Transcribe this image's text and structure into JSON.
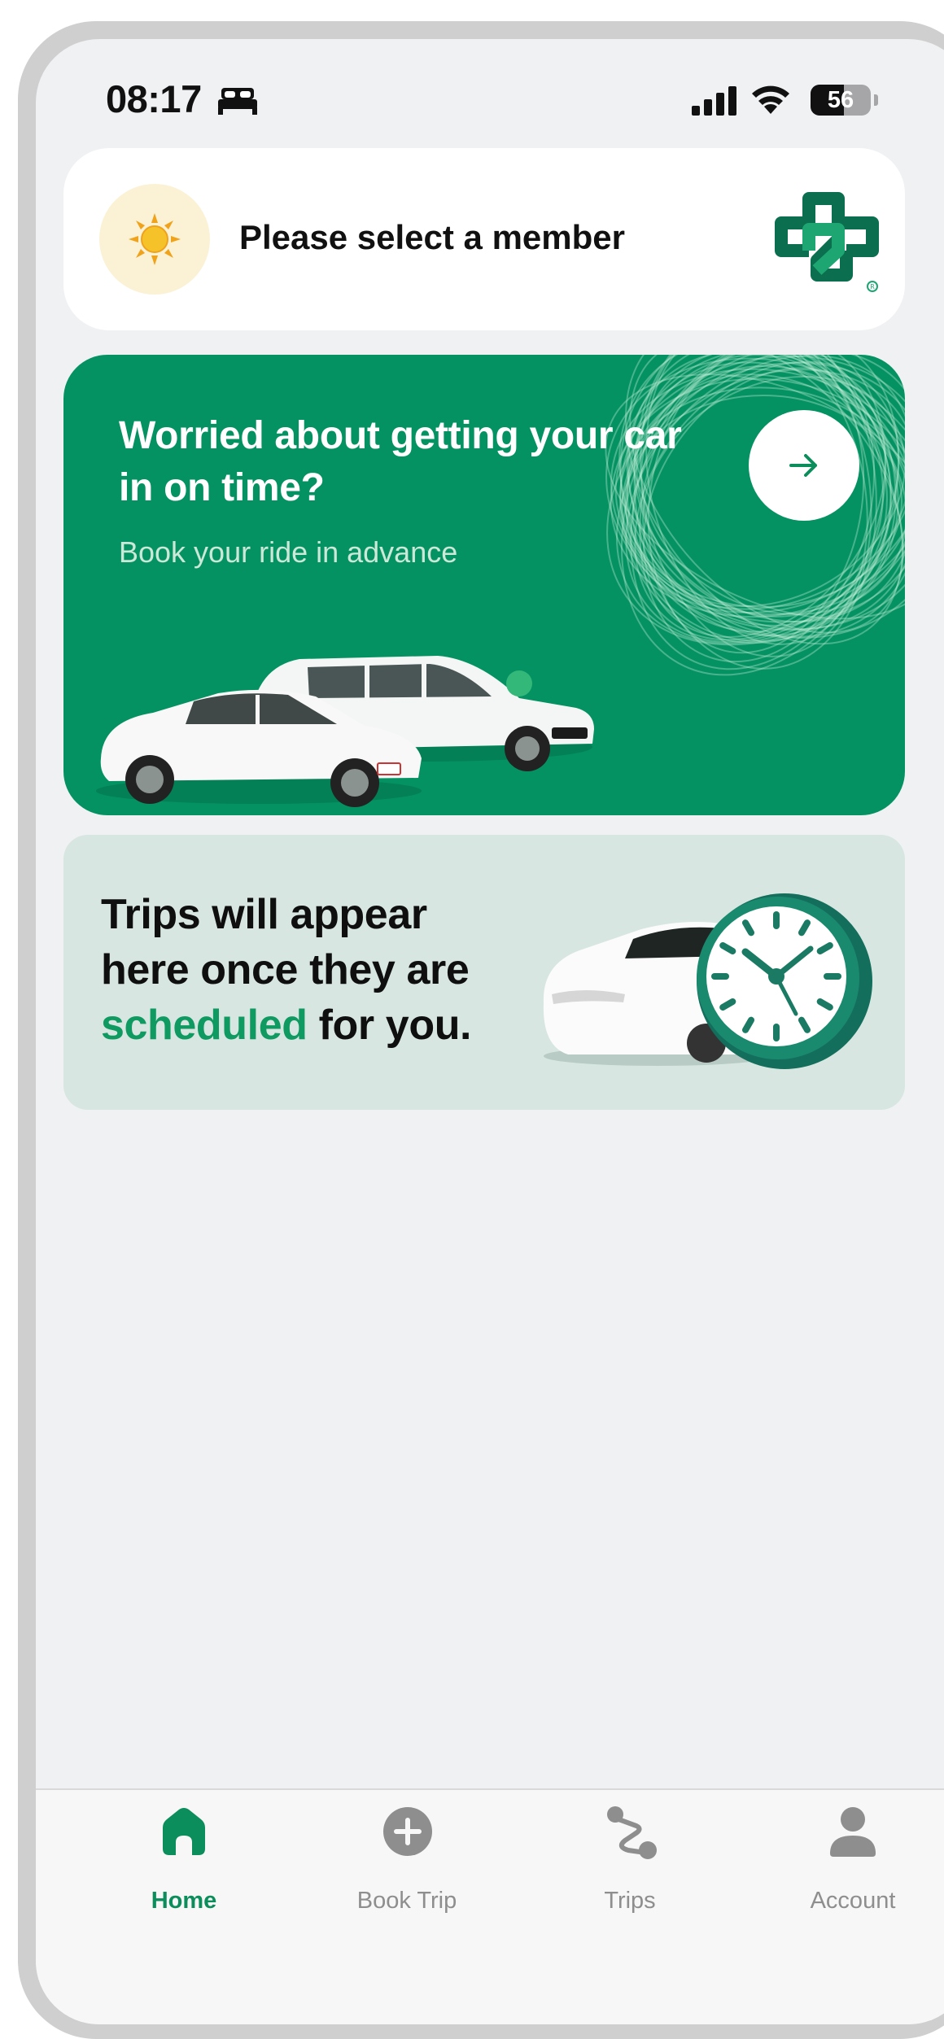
{
  "status_bar": {
    "time": "08:17",
    "battery_level": "56",
    "battery_fraction": 0.56,
    "icons": [
      "bed-icon",
      "signal-icon",
      "wifi-icon",
      "battery-icon"
    ]
  },
  "member_card": {
    "label": "Please select a member",
    "icons": [
      "sun-icon",
      "brand-logo-icon"
    ]
  },
  "promo_card": {
    "title": "Worried about getting your car in on time?",
    "subtitle": "Book your ride in advance",
    "icons": [
      "arrow-right-icon"
    ]
  },
  "trips_empty": {
    "line1": "Trips will appear",
    "line2": "here once they are",
    "accent_word": "scheduled",
    "line3_rest": " for you."
  },
  "tab_bar": {
    "tabs": [
      {
        "label": "Home",
        "icon": "home-icon",
        "active": true
      },
      {
        "label": "Book Trip",
        "icon": "plus-circle-icon",
        "active": false
      },
      {
        "label": "Trips",
        "icon": "route-icon",
        "active": false
      },
      {
        "label": "Account",
        "icon": "person-icon",
        "active": false
      }
    ]
  },
  "colors": {
    "brand_green": "#049262",
    "brand_green_dark": "#0b6e4f",
    "accent_green": "#0e9a60",
    "card_mint": "#d7e6e0",
    "screen_bg": "#f0f1f3"
  }
}
